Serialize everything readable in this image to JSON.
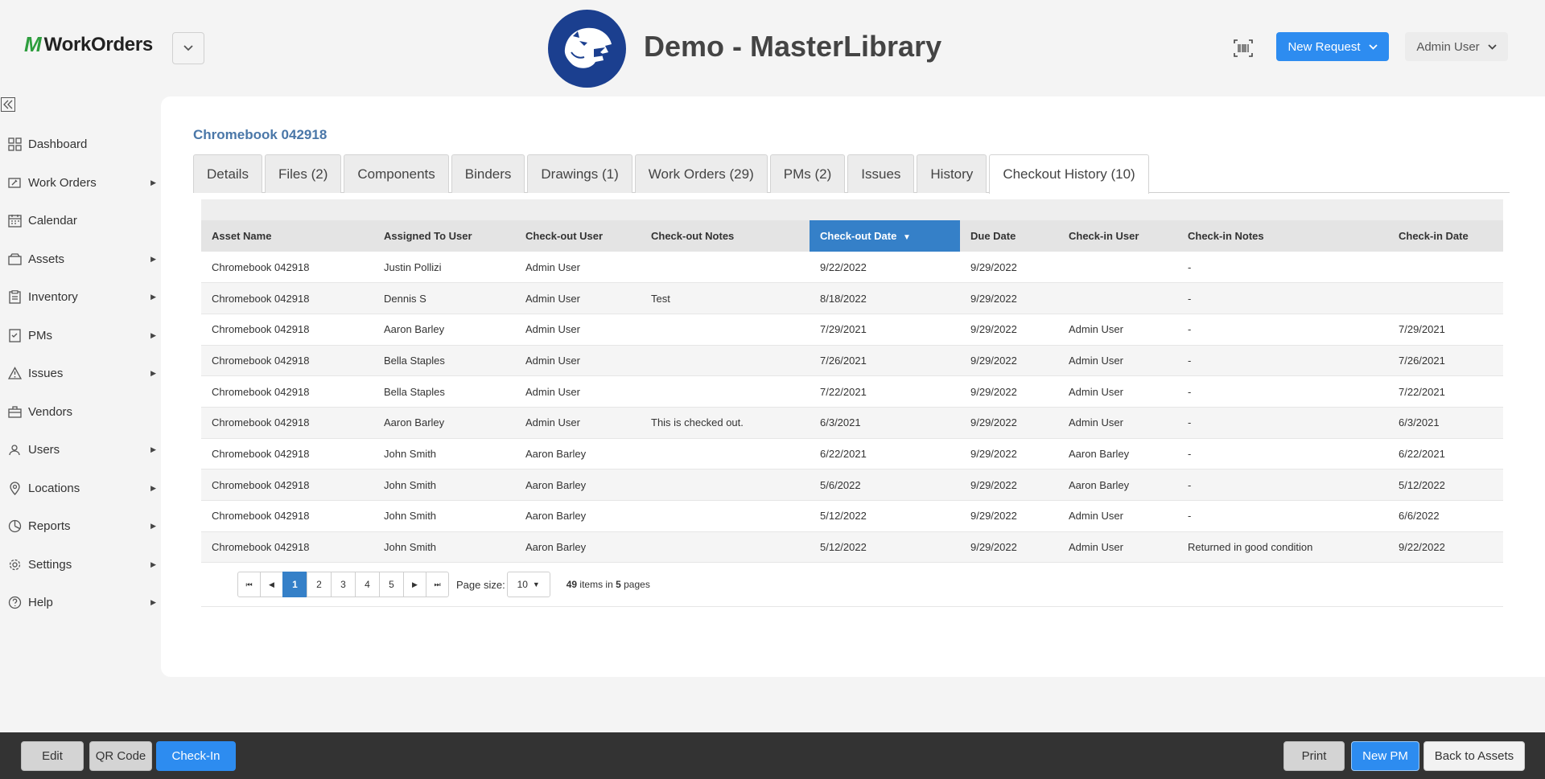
{
  "header": {
    "logo_text": "WorkOrders",
    "site_title": "Demo - MasterLibrary",
    "new_request_label": "New Request",
    "user_menu_label": "Admin User"
  },
  "sidebar": {
    "items": [
      {
        "label": "Dashboard",
        "icon": "grid-icon",
        "has_submenu": false
      },
      {
        "label": "Work Orders",
        "icon": "wrench-icon",
        "has_submenu": true
      },
      {
        "label": "Calendar",
        "icon": "calendar-icon",
        "has_submenu": false
      },
      {
        "label": "Assets",
        "icon": "box-icon",
        "has_submenu": true
      },
      {
        "label": "Inventory",
        "icon": "clipboard-icon",
        "has_submenu": true
      },
      {
        "label": "PMs",
        "icon": "checklist-icon",
        "has_submenu": true
      },
      {
        "label": "Issues",
        "icon": "warning-icon",
        "has_submenu": true
      },
      {
        "label": "Vendors",
        "icon": "briefcase-icon",
        "has_submenu": false
      },
      {
        "label": "Users",
        "icon": "users-icon",
        "has_submenu": true
      },
      {
        "label": "Locations",
        "icon": "pin-icon",
        "has_submenu": true
      },
      {
        "label": "Reports",
        "icon": "pie-icon",
        "has_submenu": true
      },
      {
        "label": "Settings",
        "icon": "gear-icon",
        "has_submenu": true
      },
      {
        "label": "Help",
        "icon": "help-icon",
        "has_submenu": true
      }
    ]
  },
  "asset": {
    "title": "Chromebook 042918"
  },
  "tabs": [
    {
      "label": "Details",
      "active": false
    },
    {
      "label": "Files (2)",
      "active": false
    },
    {
      "label": "Components",
      "active": false
    },
    {
      "label": "Binders",
      "active": false
    },
    {
      "label": "Drawings (1)",
      "active": false
    },
    {
      "label": "Work Orders (29)",
      "active": false
    },
    {
      "label": "PMs (2)",
      "active": false
    },
    {
      "label": "Issues",
      "active": false
    },
    {
      "label": "History",
      "active": false
    },
    {
      "label": "Checkout History (10)",
      "active": true
    }
  ],
  "grid": {
    "columns": [
      "Asset Name",
      "Assigned To User",
      "Check-out User",
      "Check-out Notes",
      "Check-out Date",
      "Due Date",
      "Check-in User",
      "Check-in Notes",
      "Check-in Date"
    ],
    "sorted_column": "Check-out Date",
    "rows": [
      [
        "Chromebook 042918",
        "Justin Pollizi",
        "Admin User",
        "",
        "9/22/2022",
        "9/29/2022",
        "",
        "-",
        ""
      ],
      [
        "Chromebook 042918",
        "Dennis S",
        "Admin User",
        "Test",
        "8/18/2022",
        "9/29/2022",
        "",
        "-",
        ""
      ],
      [
        "Chromebook 042918",
        "Aaron Barley",
        "Admin User",
        "",
        "7/29/2021",
        "9/29/2022",
        "Admin User",
        "-",
        "7/29/2021"
      ],
      [
        "Chromebook 042918",
        "Bella Staples",
        "Admin User",
        "",
        "7/26/2021",
        "9/29/2022",
        "Admin User",
        "-",
        "7/26/2021"
      ],
      [
        "Chromebook 042918",
        "Bella Staples",
        "Admin User",
        "",
        "7/22/2021",
        "9/29/2022",
        "Admin User",
        "-",
        "7/22/2021"
      ],
      [
        "Chromebook 042918",
        "Aaron Barley",
        "Admin User",
        "This is checked out.",
        "6/3/2021",
        "9/29/2022",
        "Admin User",
        "-",
        "6/3/2021"
      ],
      [
        "Chromebook 042918",
        "John Smith",
        "Aaron Barley",
        "",
        "6/22/2021",
        "9/29/2022",
        "Aaron Barley",
        "-",
        "6/22/2021"
      ],
      [
        "Chromebook 042918",
        "John Smith",
        "Aaron Barley",
        "",
        "5/6/2022",
        "9/29/2022",
        "Aaron Barley",
        "-",
        "5/12/2022"
      ],
      [
        "Chromebook 042918",
        "John Smith",
        "Aaron Barley",
        "",
        "5/12/2022",
        "9/29/2022",
        "Admin User",
        "-",
        "6/6/2022"
      ],
      [
        "Chromebook 042918",
        "John Smith",
        "Aaron Barley",
        "",
        "5/12/2022",
        "9/29/2022",
        "Admin User",
        "Returned in good condition",
        "9/22/2022"
      ]
    ]
  },
  "pager": {
    "pages": [
      "1",
      "2",
      "3",
      "4",
      "5"
    ],
    "current_page": "1",
    "page_size_label": "Page size:",
    "page_size": "10",
    "total_items": "49",
    "items_in_text": "items in",
    "total_pages": "5",
    "pages_text": "pages"
  },
  "footer": {
    "edit_label": "Edit",
    "qr_label": "QR Code",
    "checkin_label": "Check-In",
    "print_label": "Print",
    "new_pm_label": "New PM",
    "back_label": "Back to Assets"
  },
  "colors": {
    "accent_blue": "#2d8cf0",
    "sorted_header": "#3580c8",
    "asset_title": "#4a77a8",
    "logo_green": "#2e9e3e",
    "mascot_bg": "#1b3f8f",
    "footer_bg": "#333333"
  }
}
